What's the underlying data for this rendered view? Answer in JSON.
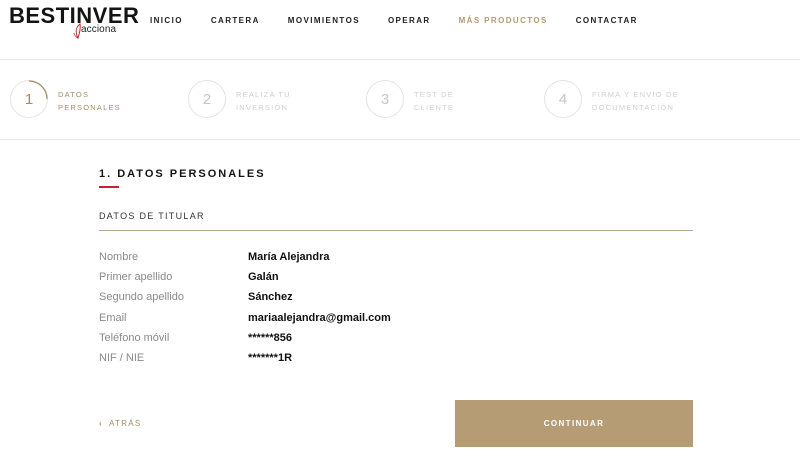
{
  "brand": {
    "name": "BESTINVER",
    "sub": "acciona"
  },
  "nav": [
    {
      "label": "INICIO"
    },
    {
      "label": "CARTERA"
    },
    {
      "label": "MOVIMIENTOS"
    },
    {
      "label": "OPERAR"
    },
    {
      "label": "MÁS PRODUCTOS"
    },
    {
      "label": "CONTACTAR"
    }
  ],
  "steps": [
    {
      "number": "1",
      "line1": "DATOS",
      "line2": "PERSONALES"
    },
    {
      "number": "2",
      "line1": "REALIZA TU",
      "line2": "INVERSIÓN"
    },
    {
      "number": "3",
      "line1": "TEST DE",
      "line2": "CLIENTE"
    },
    {
      "number": "4",
      "line1": "FIRMA Y ENVÍO DE",
      "line2": "DOCUMENTACIÓN"
    }
  ],
  "section": {
    "title": "1. DATOS PERSONALES",
    "subtitle": "DATOS DE TITULAR"
  },
  "fields": [
    {
      "label": "Nombre",
      "value": "María Alejandra"
    },
    {
      "label": "Primer apellido",
      "value": "Galán"
    },
    {
      "label": "Segundo apellido",
      "value": "Sánchez"
    },
    {
      "label": "Email",
      "value": "mariaalejandra@gmail.com"
    },
    {
      "label": "Teléfono móvil",
      "value": "******856"
    },
    {
      "label": "NIF / NIE",
      "value": "*******1R"
    }
  ],
  "actions": {
    "back_label": "ATRÁS",
    "continue_label": "CONTINUAR"
  },
  "colors": {
    "accent": "#b59c74",
    "accent_text": "#a58b66",
    "title_rule": "#c0262d"
  }
}
